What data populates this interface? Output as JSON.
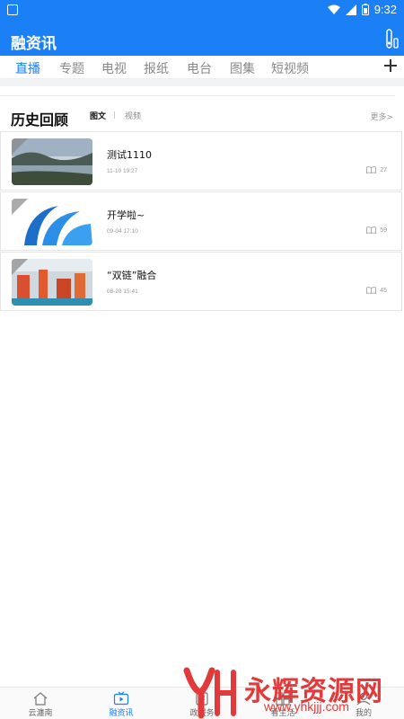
{
  "status_bar": {
    "time": "9:32"
  },
  "app_bar": {
    "title": "融资讯"
  },
  "tabs": [
    {
      "label": "直播",
      "active": true
    },
    {
      "label": "专题",
      "active": false
    },
    {
      "label": "电视",
      "active": false
    },
    {
      "label": "报纸",
      "active": false
    },
    {
      "label": "电台",
      "active": false
    },
    {
      "label": "图集",
      "active": false
    },
    {
      "label": "短视频",
      "active": false
    }
  ],
  "section": {
    "title": "历史回顾",
    "sub_tabs": [
      {
        "label": "图文",
        "active": true
      },
      {
        "label": "视频",
        "active": false
      }
    ],
    "more": "更多>"
  },
  "items": [
    {
      "title": "测试1110",
      "date": "11-10 19:27",
      "views": "27",
      "thumb_icon": "lake-landscape-thumbnail"
    },
    {
      "title": "开学啦~",
      "date": "09-04 17:10",
      "views": "59",
      "thumb_icon": "blue-logo-thumbnail"
    },
    {
      "title": "“双链”融合",
      "date": "08-28 15:41",
      "views": "45",
      "thumb_icon": "factory-robots-thumbnail"
    }
  ],
  "bottom_nav": [
    {
      "label": "云瀍南",
      "icon": "home-icon",
      "active": false
    },
    {
      "label": "融资讯",
      "icon": "tv-icon",
      "active": true
    },
    {
      "label": "政服务",
      "icon": "service-icon",
      "active": false
    },
    {
      "label": "看生活",
      "icon": "life-icon",
      "active": false
    },
    {
      "label": "我的",
      "icon": "user-icon",
      "active": false
    }
  ],
  "watermark": {
    "text": "永辉资源网",
    "url": "www.yhkjjj.com"
  },
  "colors": {
    "brand": "#1b7ff5",
    "watermark": "#e23a3a"
  }
}
